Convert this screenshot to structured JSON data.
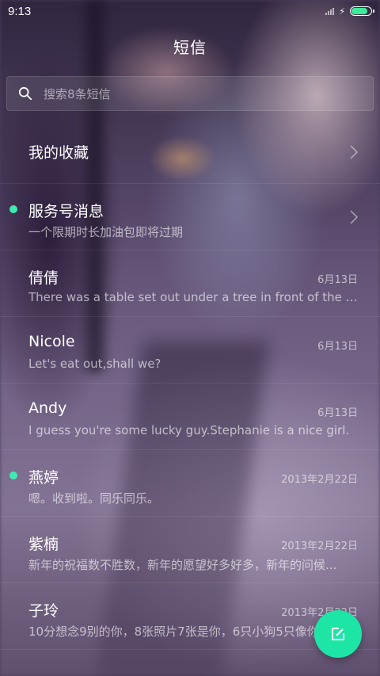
{
  "status_bar": {
    "time": "9:13",
    "battery_level": 0.85,
    "battery_color": "#3dea9c"
  },
  "header": {
    "title": "短信"
  },
  "search": {
    "placeholder": "搜索8条短信"
  },
  "favorites": {
    "label": "我的收藏"
  },
  "messages": [
    {
      "name": "服务号消息",
      "date": "",
      "preview": "一个限期时长加油包即将过期",
      "unread": true,
      "chevron": true
    },
    {
      "name": "倩倩",
      "date": "6月13日",
      "preview": "There was a table set out under a tree in front of the ho...",
      "unread": false
    },
    {
      "name": "Nicole",
      "date": "6月13日",
      "preview": "Let's eat out,shall we?",
      "unread": false
    },
    {
      "name": "Andy",
      "date": "6月13日",
      "preview": "I guess you're some lucky guy.Stephanie is a nice girl.",
      "unread": false
    },
    {
      "name": "燕婷",
      "date": "2013年2月22日",
      "preview": "嗯。收到啦。同乐同乐。",
      "unread": true
    },
    {
      "name": "紫楠",
      "date": "2013年2月22日",
      "preview": "新年的祝福数不胜数，新年的愿望好多好多，新年的问候...",
      "unread": false
    },
    {
      "name": "子玲",
      "date": "2013年2月22日",
      "preview": "10分想念9别的你，8张照片7张是你，6只小狗5只像你",
      "unread": false
    }
  ],
  "fab": {
    "icon": "compose-icon",
    "color": "#1de5a6"
  }
}
